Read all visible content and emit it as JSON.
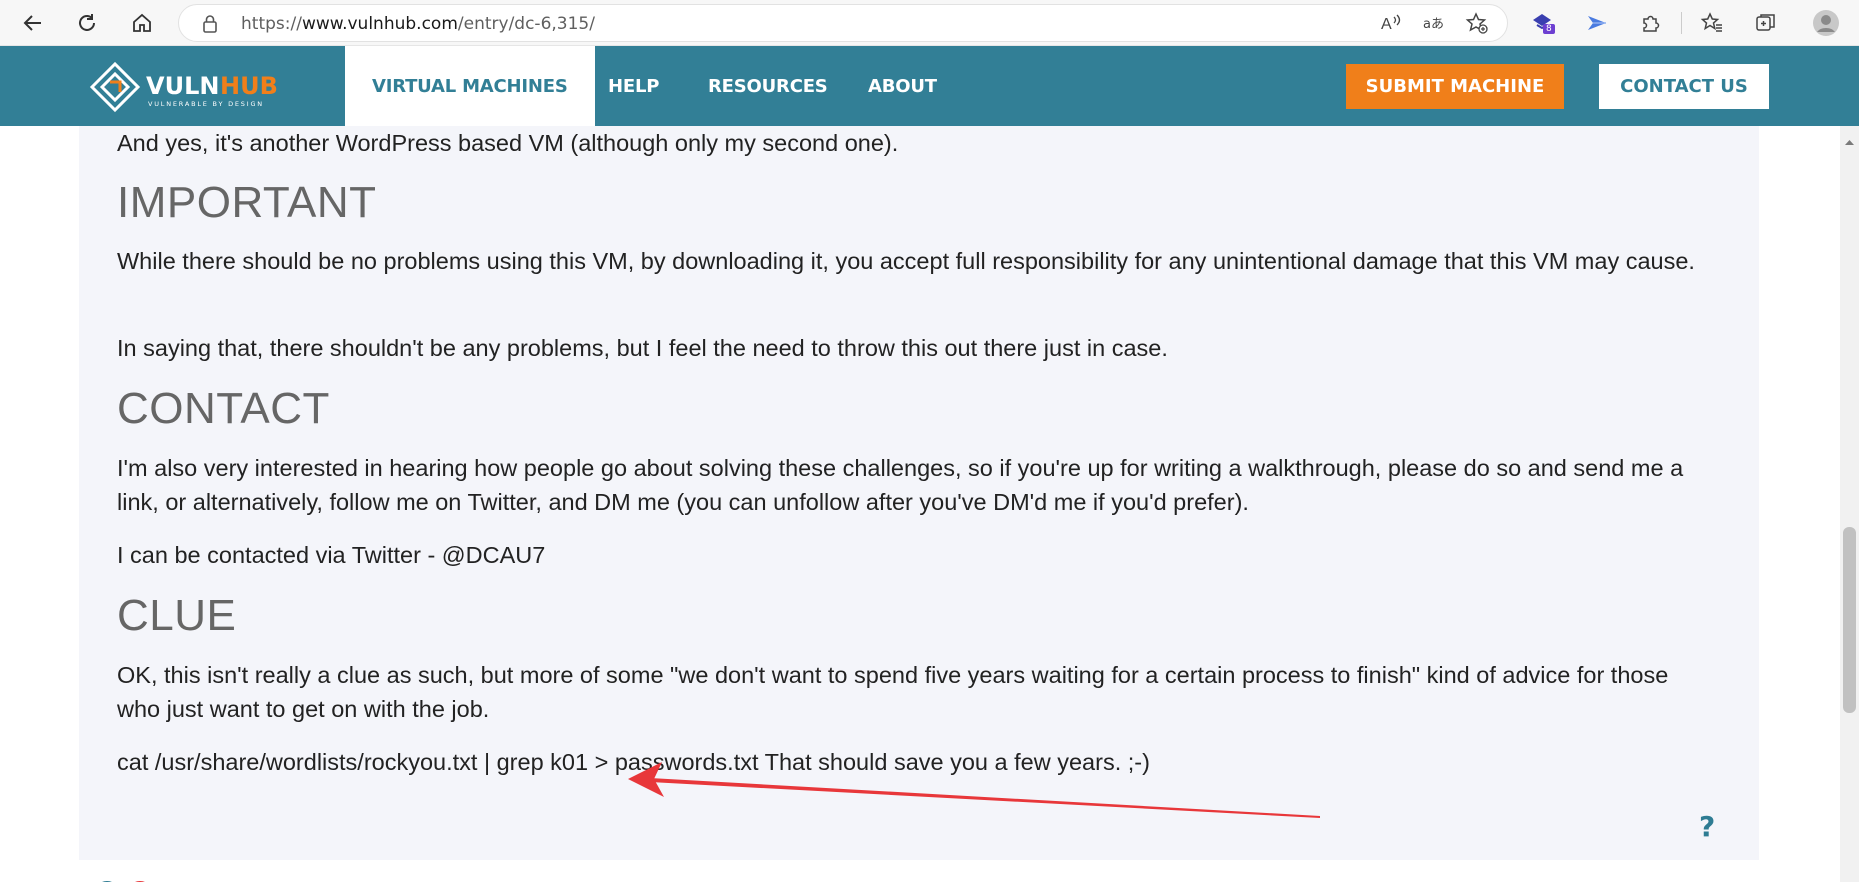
{
  "browser": {
    "url_prefix": "https://",
    "url_host": "www.vulnhub.com",
    "url_path": "/entry/dc-6,315/",
    "extensions_badge": "8",
    "icons": [
      "back-icon",
      "refresh-icon",
      "home-icon",
      "lock-icon",
      "read-aloud-icon",
      "translate-icon",
      "add-favorite-icon",
      "extension-icon",
      "puzzle-icon",
      "favorites-icon",
      "collections-icon",
      "profile-icon"
    ]
  },
  "header": {
    "logo_text": "VULNHUB",
    "logo_tagline": "VULNERABLE BY DESIGN",
    "nav": [
      {
        "label": "VIRTUAL MACHINES",
        "active": true
      },
      {
        "label": "HELP",
        "active": false
      },
      {
        "label": "RESOURCES",
        "active": false
      },
      {
        "label": "ABOUT",
        "active": false
      }
    ],
    "submit_label": "SUBMIT MACHINE",
    "contact_label": "CONTACT US",
    "colors": {
      "header_bg": "#327f96",
      "submit_bg": "#f07f1a"
    }
  },
  "article": {
    "intro": "And yes, it's another WordPress based VM (although only my second one).",
    "important_heading": "IMPORTANT",
    "important_p1": "While there should be no problems using this VM, by downloading it, you accept full responsibility for any unintentional damage that this VM may cause.",
    "important_p2": "In saying that, there shouldn't be any problems, but I feel the need to throw this out there just in case.",
    "contact_heading": "CONTACT",
    "contact_p1": "I'm also very interested in hearing how people go about solving these challenges, so if you're up for writing a walkthrough, please do so and send me a link, or alternatively, follow me on Twitter, and DM me (you can unfollow after you've DM'd me if you'd prefer).",
    "contact_p2": "I can be contacted via Twitter - @DCAU7",
    "clue_heading": "CLUE",
    "clue_p1": "OK, this isn't really a clue as such, but more of some \"we don't want to spend five years waiting for a certain process to finish\" kind of advice for those who just want to get on with the job.",
    "clue_p2": "cat /usr/share/wordlists/rockyou.txt | grep k01 > passwords.txt That should save you a few years. ;-)"
  },
  "help_label": "?",
  "annotation": {
    "color": "#e8373a"
  }
}
